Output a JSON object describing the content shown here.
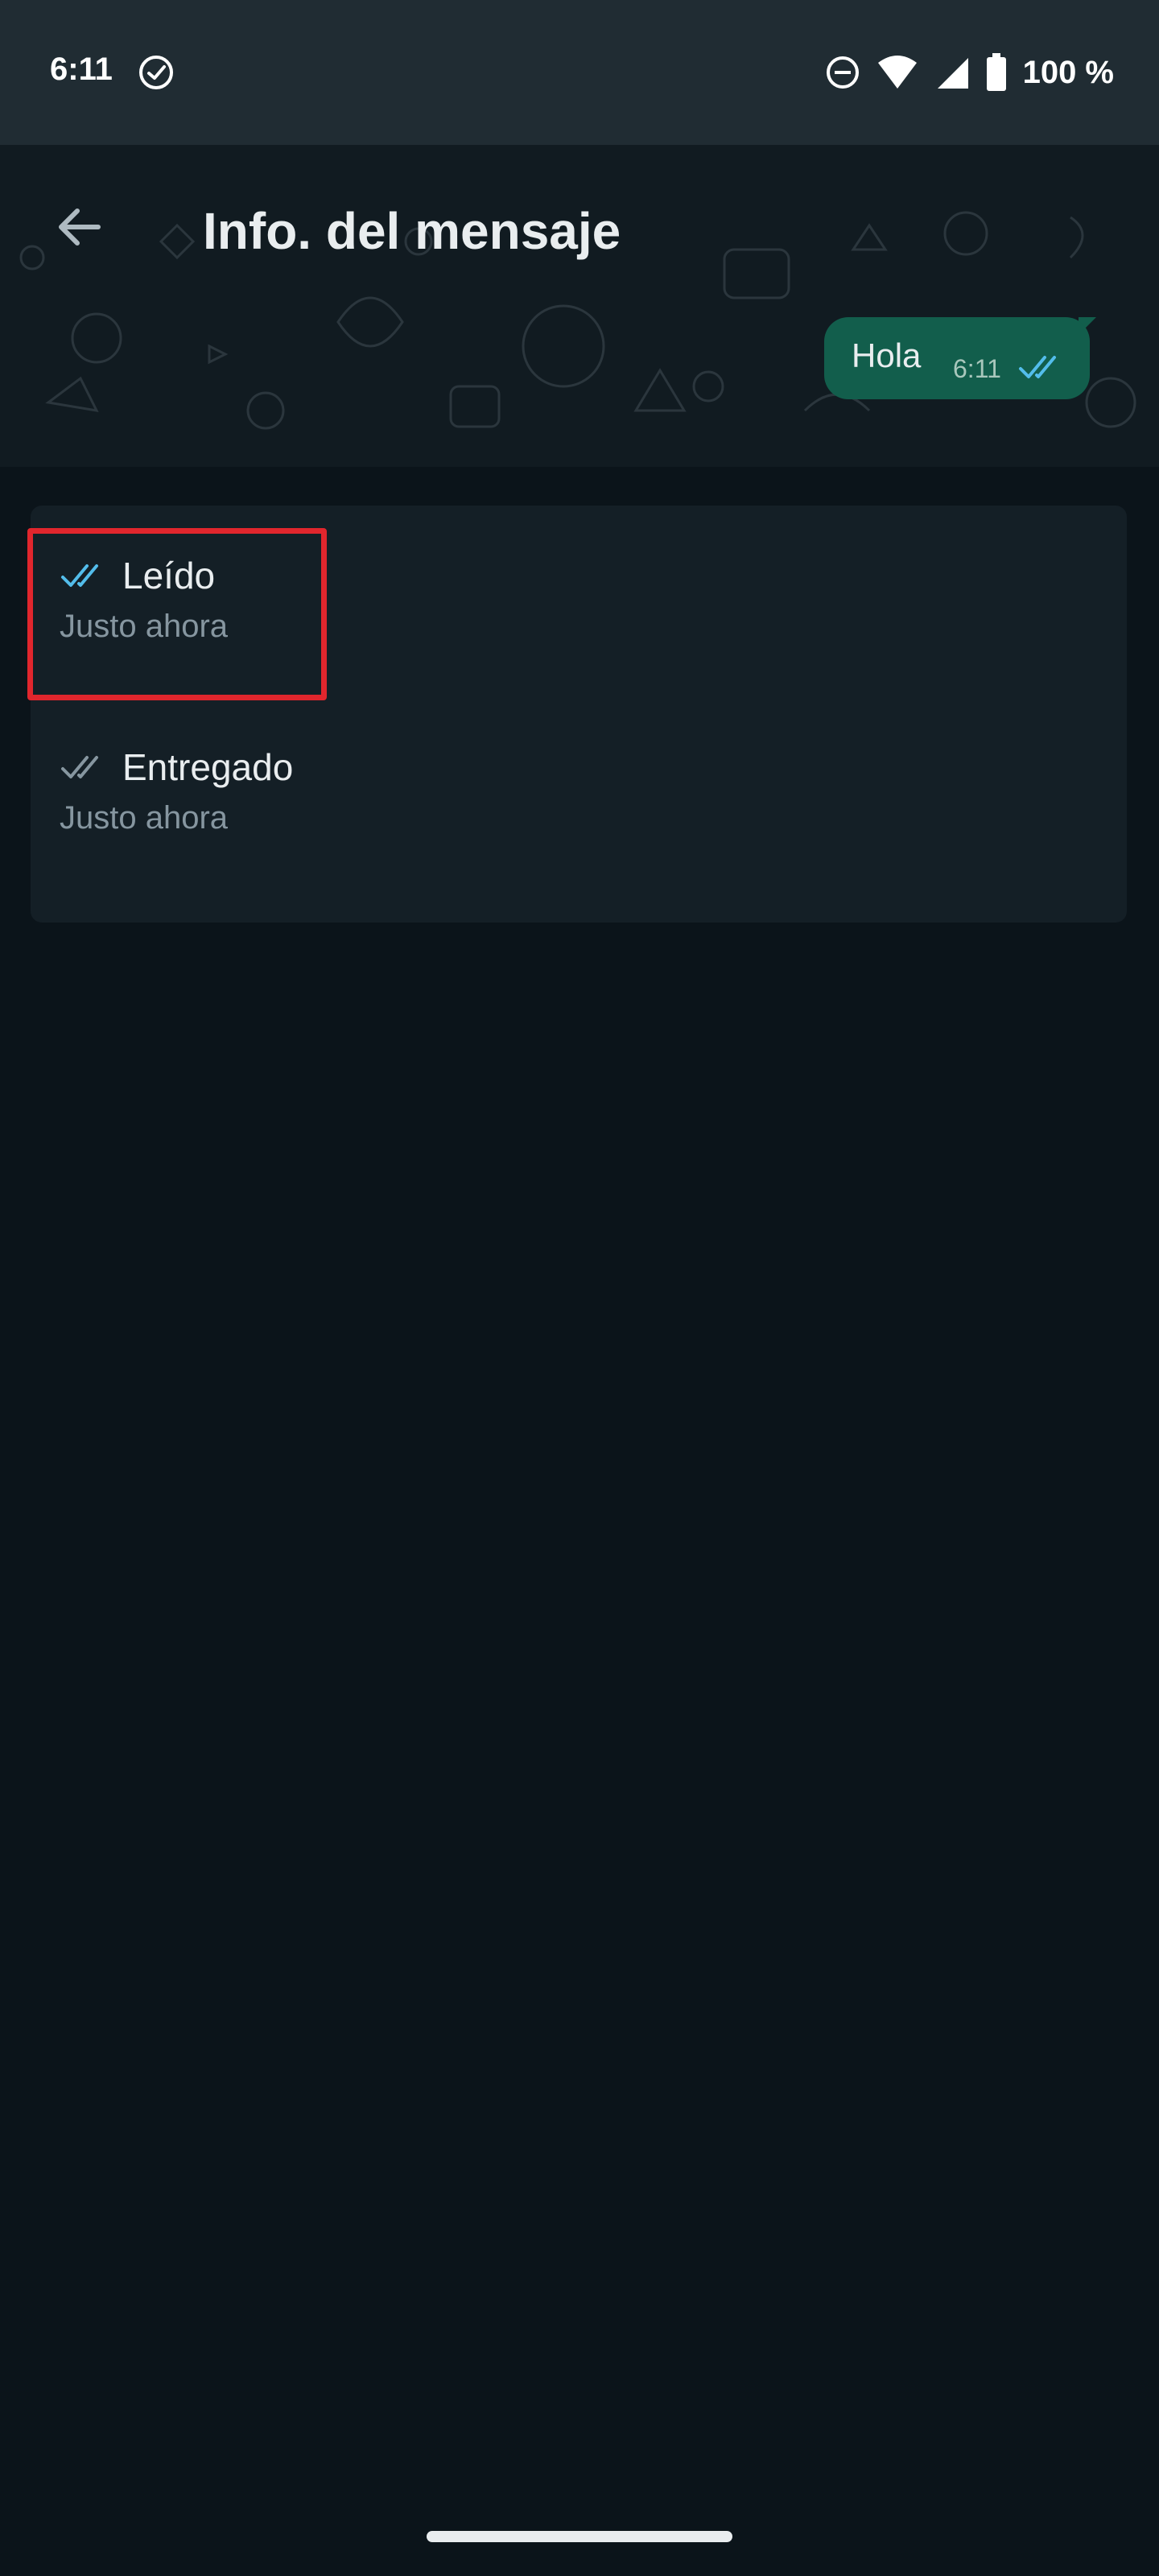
{
  "status_bar": {
    "time": "6:11",
    "battery": "100 %"
  },
  "header": {
    "title": "Info. del mensaje",
    "back_icon": "arrow-left-icon"
  },
  "message": {
    "text": "Hola",
    "time": "6:11",
    "status_icon": "double-check-icon",
    "status_color": "#53bdeb"
  },
  "receipts": [
    {
      "label": "Leído",
      "time": "Justo ahora",
      "icon": "double-check-icon",
      "color": "#53bdeb"
    },
    {
      "label": "Entregado",
      "time": "Justo ahora",
      "icon": "double-check-icon",
      "color": "#8696a0"
    }
  ],
  "colors": {
    "background": "#0b141a",
    "status_bar": "#202c33",
    "bubble": "#125e4c",
    "card": "#141f26",
    "highlight": "#e1262d"
  }
}
